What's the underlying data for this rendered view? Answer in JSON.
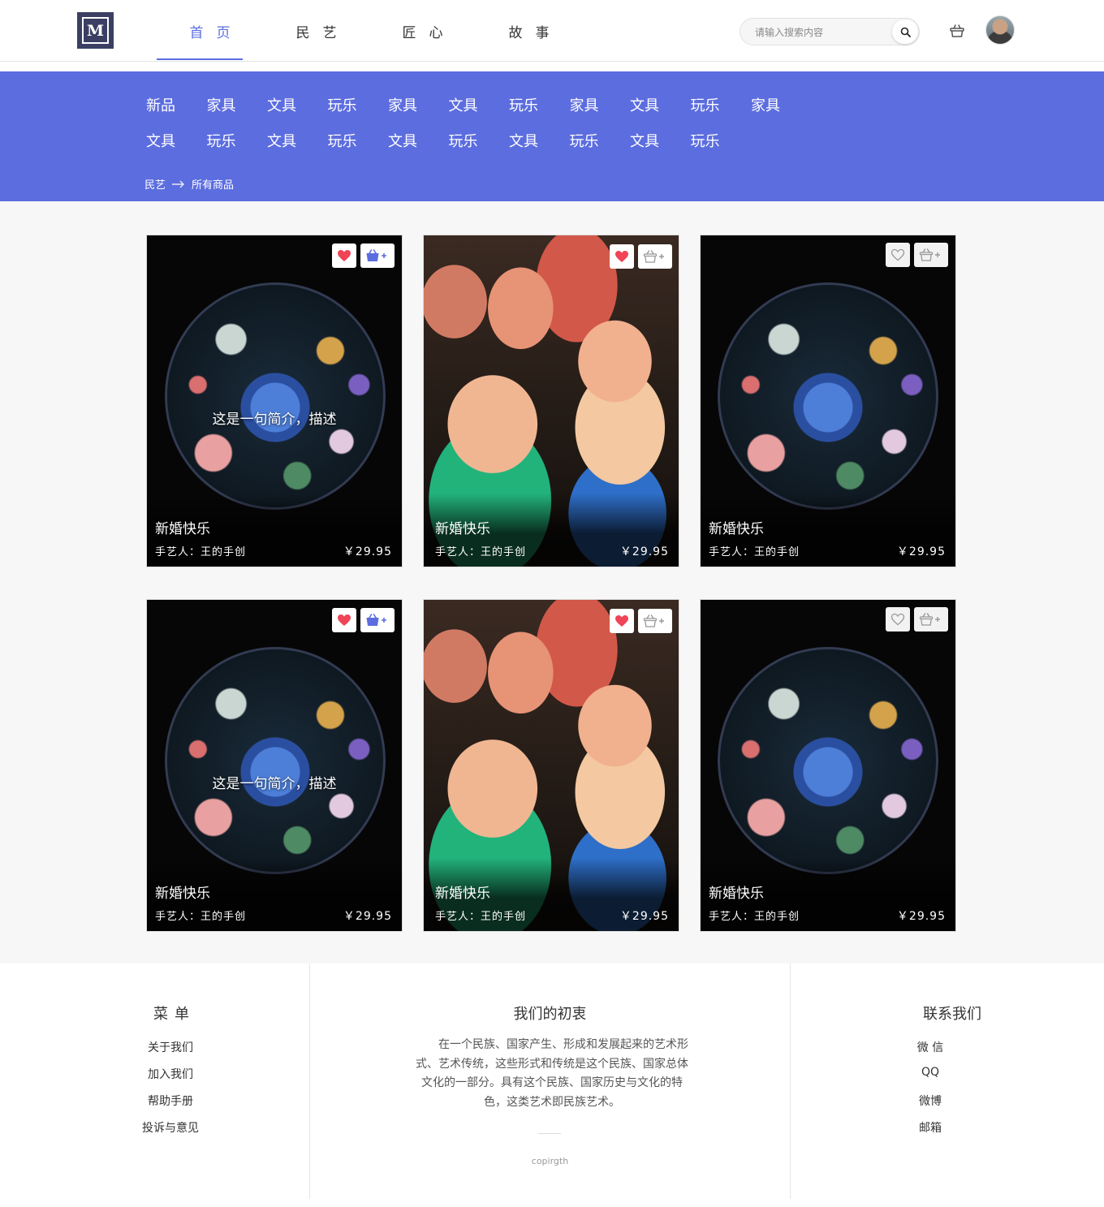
{
  "brand": {
    "logo_letter": "M"
  },
  "nav": [
    {
      "label": "首页",
      "active": true
    },
    {
      "label": "民艺",
      "active": false
    },
    {
      "label": "匠心",
      "active": false
    },
    {
      "label": "故事",
      "active": false
    }
  ],
  "search": {
    "placeholder": "请输入搜索内容",
    "value": ""
  },
  "icons": {
    "search": "search-icon",
    "cart": "basket-icon",
    "avatar": "user-avatar"
  },
  "colors": {
    "accent": "#5c6ddf",
    "like": "#f04457"
  },
  "categories": {
    "row1": [
      "新品",
      "家具",
      "文具",
      "玩乐",
      "家具",
      "文具",
      "玩乐",
      "家具",
      "文具",
      "玩乐",
      "家具"
    ],
    "row2": [
      "文具",
      "玩乐",
      "文具",
      "玩乐",
      "文具",
      "玩乐",
      "文具",
      "玩乐",
      "文具",
      "玩乐"
    ]
  },
  "breadcrumb": {
    "root": "民艺",
    "current": "所有商品"
  },
  "products": [
    {
      "name": "新婚快乐",
      "maker": "手艺人：王的手创",
      "price": "￥29.95",
      "blurb": "这是一句简介，描述",
      "image": "embroidery",
      "liked": true,
      "in_cart": true
    },
    {
      "name": "新婚快乐",
      "maker": "手艺人：王的手创",
      "price": "￥29.95",
      "blurb": "",
      "image": "clay-dolls",
      "liked": true,
      "in_cart": false
    },
    {
      "name": "新婚快乐",
      "maker": "手艺人：王的手创",
      "price": "￥29.95",
      "blurb": "",
      "image": "embroidery",
      "liked": false,
      "in_cart": false
    },
    {
      "name": "新婚快乐",
      "maker": "手艺人：王的手创",
      "price": "￥29.95",
      "blurb": "这是一句简介，描述",
      "image": "embroidery",
      "liked": true,
      "in_cart": true
    },
    {
      "name": "新婚快乐",
      "maker": "手艺人：王的手创",
      "price": "￥29.95",
      "blurb": "",
      "image": "clay-dolls",
      "liked": true,
      "in_cart": false
    },
    {
      "name": "新婚快乐",
      "maker": "手艺人：王的手创",
      "price": "￥29.95",
      "blurb": "",
      "image": "embroidery",
      "liked": false,
      "in_cart": false
    }
  ],
  "footer": {
    "menu": {
      "title": "菜单",
      "links": [
        "关于我们",
        "加入我们",
        "帮助手册",
        "投诉与意见"
      ]
    },
    "mission": {
      "title": "我们的初衷",
      "text": "在一个民族、国家产生、形成和发展起来的艺术形式、艺术传统，这些形式和传统是这个民族、国家总体文化的一部分。具有这个民族、国家历史与文化的特色，这类艺术即民族艺术。",
      "copyright": "copirgth"
    },
    "contact": {
      "title": "联系我们",
      "links": [
        "微 信",
        "QQ",
        "微博",
        "邮箱"
      ]
    }
  }
}
